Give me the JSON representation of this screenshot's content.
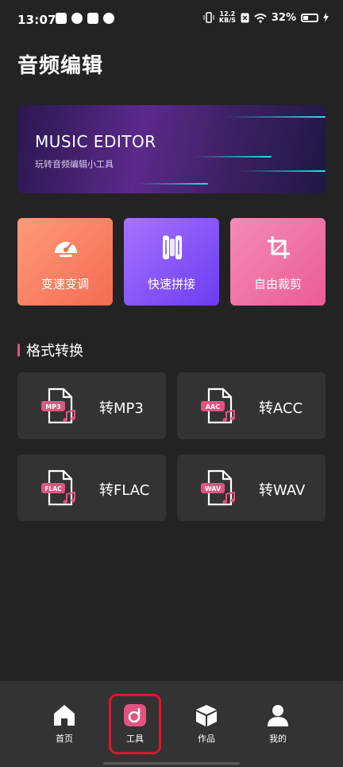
{
  "status_bar": {
    "time": "13:07",
    "net_speed_top": "12.2",
    "net_speed_bottom": "KB/S",
    "battery": "32%"
  },
  "page_title": "音频编辑",
  "banner": {
    "title": "MUSIC EDITOR",
    "subtitle": "玩转音频编辑小工具"
  },
  "tools": [
    {
      "label": "变速变调",
      "icon": "speedometer-icon"
    },
    {
      "label": "快速拼接",
      "icon": "splice-icon"
    },
    {
      "label": "自由裁剪",
      "icon": "crop-icon"
    }
  ],
  "section_title": "格式转换",
  "formats": [
    {
      "badge": "MP3",
      "label": "转MP3"
    },
    {
      "badge": "AAC",
      "label": "转ACC"
    },
    {
      "badge": "FLAC",
      "label": "转FLAC"
    },
    {
      "badge": "WAV",
      "label": "转WAV"
    }
  ],
  "nav": [
    {
      "label": "首页",
      "icon": "home-icon"
    },
    {
      "label": "工具",
      "icon": "tools-icon",
      "active": true
    },
    {
      "label": "作品",
      "icon": "box-icon"
    },
    {
      "label": "我的",
      "icon": "user-icon"
    }
  ],
  "colors": {
    "background": "#232323",
    "card": "#333333",
    "accent_pink": "#e4537f",
    "highlight_red": "#e0152f"
  }
}
